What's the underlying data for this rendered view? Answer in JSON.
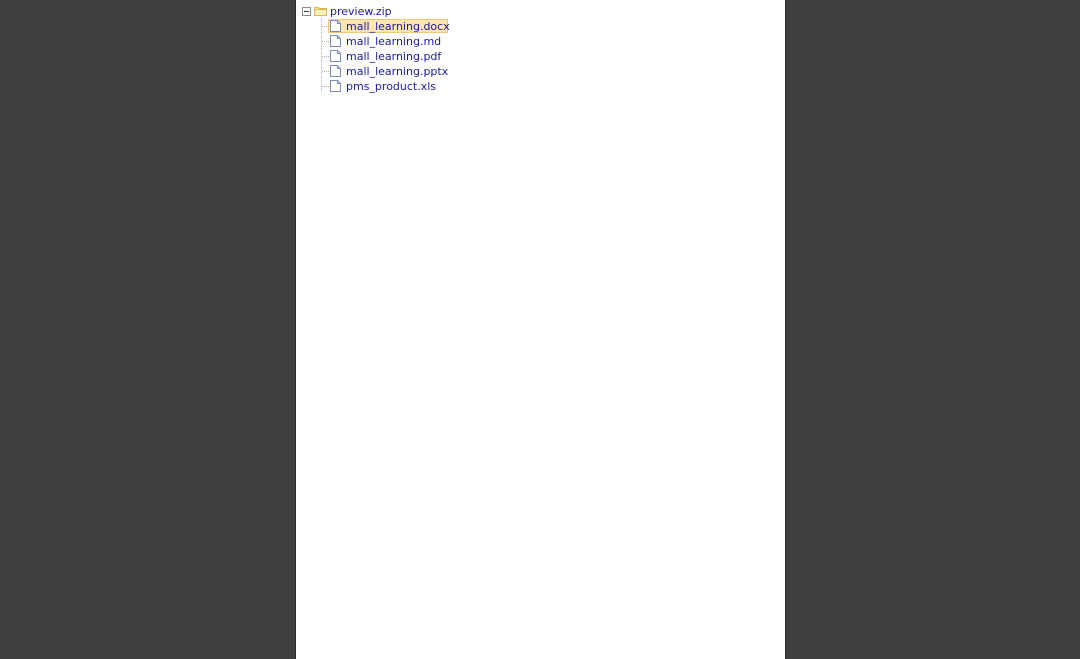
{
  "tree": {
    "root": {
      "label": "preview.zip",
      "icon": "folder-icon",
      "expanded": true
    },
    "children": [
      {
        "label": "mall_learning.docx",
        "icon": "file-icon",
        "selected": true
      },
      {
        "label": "mall_learning.md",
        "icon": "file-icon",
        "selected": false
      },
      {
        "label": "mall_learning.pdf",
        "icon": "file-icon",
        "selected": false
      },
      {
        "label": "mall_learning.pptx",
        "icon": "file-icon",
        "selected": false
      },
      {
        "label": "pms_product.xls",
        "icon": "file-icon",
        "selected": false
      }
    ]
  },
  "colors": {
    "background": "#404040",
    "panel": "#ffffff",
    "link_text": "#1a1aa6",
    "selection_fill": "#fde5b1",
    "selection_border": "#f3c778"
  }
}
